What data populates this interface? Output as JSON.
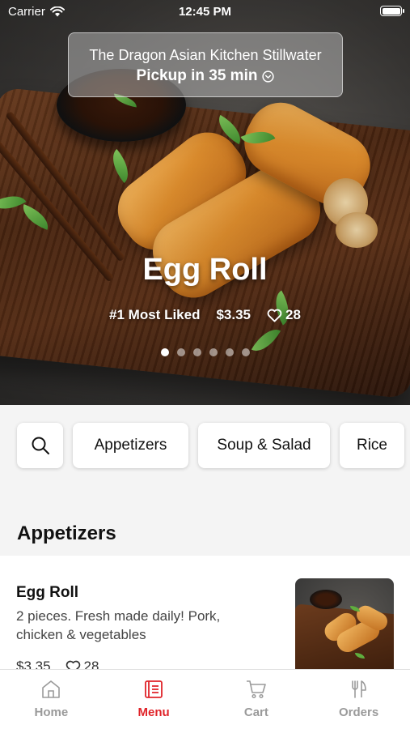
{
  "status_bar": {
    "carrier": "Carrier",
    "time": "12:45 PM"
  },
  "pickup": {
    "restaurant": "The Dragon Asian Kitchen Stillwater",
    "label": "Pickup in 35 min"
  },
  "featured": {
    "title": "Egg Roll",
    "badge": "#1 Most Liked",
    "price": "$3.35",
    "likes": "28",
    "slide_count": 6,
    "active_slide": 1
  },
  "categories": [
    {
      "label": "Appetizers"
    },
    {
      "label": "Soup & Salad"
    },
    {
      "label": "Rice"
    }
  ],
  "section_title": "Appetizers",
  "menu_items": [
    {
      "name": "Egg Roll",
      "description": "2 pieces. Fresh made daily! Pork, chicken & vegetables",
      "price": "$3.35",
      "likes": "28"
    }
  ],
  "tabs": [
    {
      "label": "Home",
      "icon": "home-icon"
    },
    {
      "label": "Menu",
      "icon": "menu-icon",
      "active": true
    },
    {
      "label": "Cart",
      "icon": "cart-icon"
    },
    {
      "label": "Orders",
      "icon": "orders-icon"
    }
  ],
  "colors": {
    "accent": "#e0242a",
    "inactive_tab": "#9a9a9a"
  }
}
